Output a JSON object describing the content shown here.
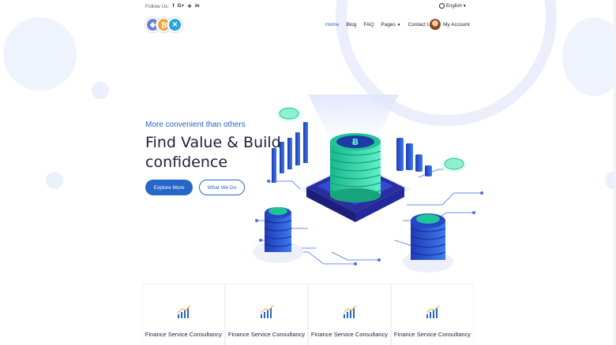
{
  "topbar": {
    "follow_label": "Follow Us:",
    "social": [
      {
        "name": "facebook-icon",
        "glyph": "f"
      },
      {
        "name": "google-plus-icon",
        "glyph": "G+"
      },
      {
        "name": "twitter-icon",
        "glyph": "✈"
      },
      {
        "name": "linkedin-icon",
        "glyph": "in"
      }
    ],
    "language": "English"
  },
  "nav": {
    "items": [
      {
        "label": "Home",
        "active": true
      },
      {
        "label": "Blog"
      },
      {
        "label": "FAQ"
      },
      {
        "label": "Pages",
        "dropdown": true
      },
      {
        "label": "Contact Us"
      }
    ],
    "account_label": "My Account"
  },
  "hero": {
    "eyebrow": "More convenient than others",
    "headline": "Find Value & Build confidence",
    "primary_button": "Explore More",
    "secondary_button": "What We Do"
  },
  "services": [
    {
      "title": "Finance Service Consultancy"
    },
    {
      "title": "Finance Service Consultancy"
    },
    {
      "title": "Finance Service Consultancy"
    },
    {
      "title": "Finance Service Consultancy"
    }
  ],
  "colors": {
    "accent": "#2567c8",
    "teal": "#2fd3a7",
    "navy": "#1b1f3b"
  }
}
